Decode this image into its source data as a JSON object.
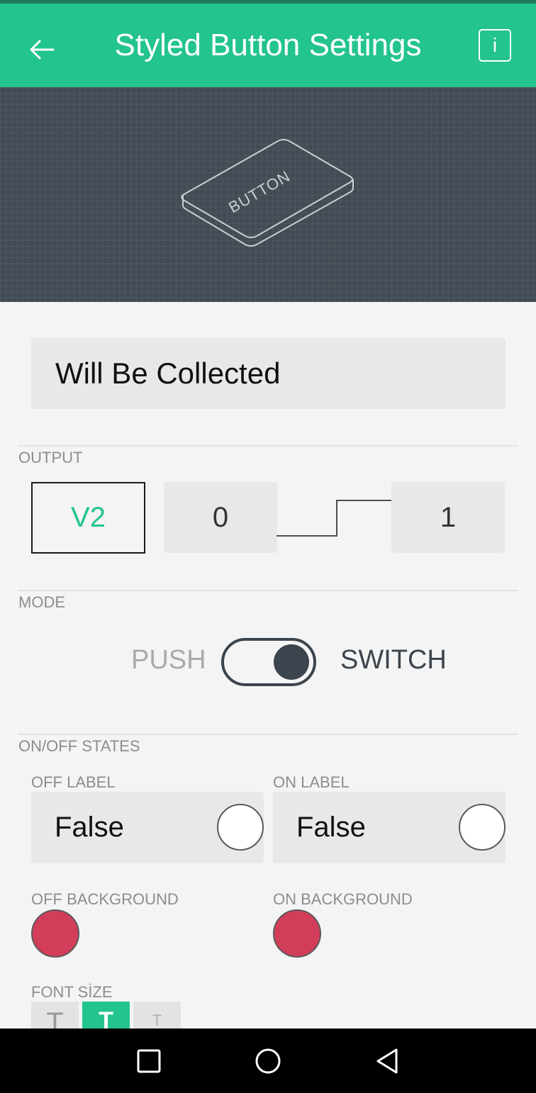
{
  "header": {
    "title": "Styled Button Settings",
    "back_icon": "arrow-left-icon",
    "info_label": "i",
    "color": "#23c48e"
  },
  "preview": {
    "button_label": "BUTTON",
    "background": "#434c55"
  },
  "widget_name": {
    "value": "Will Be Collected"
  },
  "output": {
    "label": "OUTPUT",
    "pin": "V2",
    "min": "0",
    "max": "1"
  },
  "mode": {
    "label": "MODE",
    "push": "PUSH",
    "switch": "SWITCH",
    "selected": "SWITCH"
  },
  "states": {
    "label": "ON/OFF STATES",
    "off_label": {
      "title": "OFF LABEL",
      "value": "False",
      "text_color": "#ffffff"
    },
    "on_label": {
      "title": "ON LABEL",
      "value": "False",
      "text_color": "#ffffff"
    },
    "off_background": {
      "title": "OFF BACKGROUND",
      "color": "#d23d5a"
    },
    "on_background": {
      "title": "ON BACKGROUND",
      "color": "#d23d5a"
    }
  },
  "font_size": {
    "label": "FONT SİZE",
    "options": [
      "T",
      "T",
      "T"
    ],
    "selected_index": 1
  },
  "navbar": {
    "icons": [
      "recent-apps-icon",
      "home-icon",
      "back-icon"
    ]
  }
}
